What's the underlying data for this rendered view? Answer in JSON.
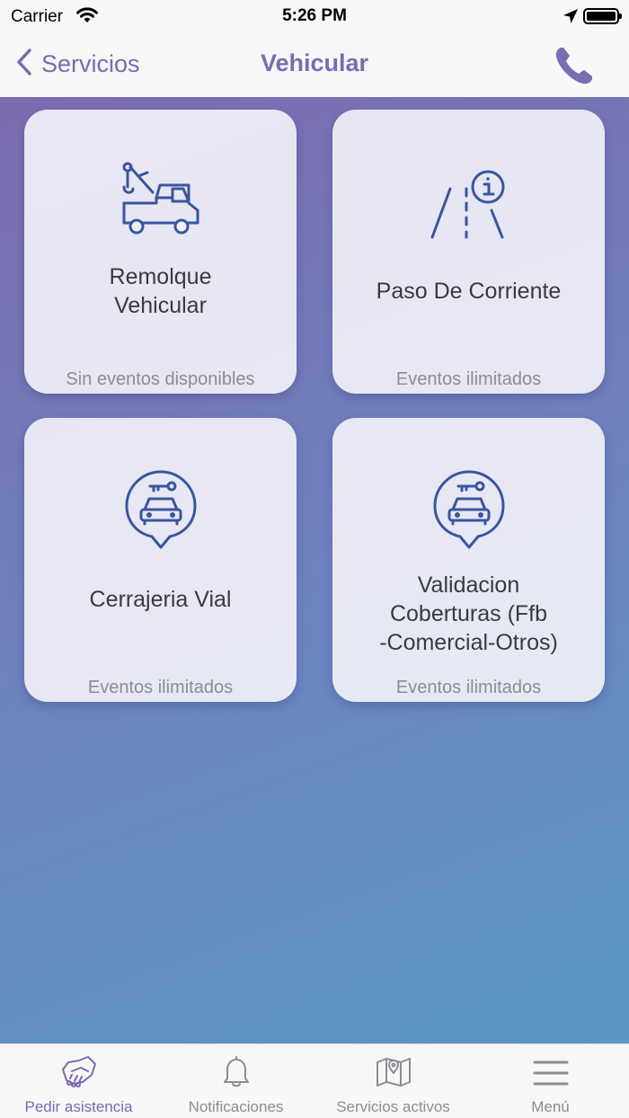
{
  "status_bar": {
    "carrier": "Carrier",
    "time": "5:26 PM"
  },
  "nav": {
    "back_label": "Servicios",
    "title": "Vehicular"
  },
  "cards": [
    {
      "title": "Remolque\nVehicular",
      "subtitle": "Sin eventos disponibles",
      "icon": "tow-truck-icon"
    },
    {
      "title": "Paso De Corriente",
      "subtitle": "Eventos ilimitados",
      "icon": "road-info-icon"
    },
    {
      "title": "Cerrajeria Vial",
      "subtitle": "Eventos ilimitados",
      "icon": "car-key-pin-icon"
    },
    {
      "title": "Validacion\nCoberturas (Ffb\n-Comercial-Otros)",
      "subtitle": "Eventos ilimitados",
      "icon": "car-key-pin-icon"
    }
  ],
  "tabs": [
    {
      "label": "Pedir asistencia",
      "icon": "handshake-icon",
      "active": true
    },
    {
      "label": "Notificaciones",
      "icon": "bell-icon",
      "active": false
    },
    {
      "label": "Servicios activos",
      "icon": "map-pin-icon",
      "active": false
    },
    {
      "label": "Menú",
      "icon": "hamburger-menu-icon",
      "active": false
    }
  ],
  "colors": {
    "accent": "#7b6bb0",
    "icon_blue": "#3a55a0",
    "tab_inactive": "#8c8c92"
  }
}
